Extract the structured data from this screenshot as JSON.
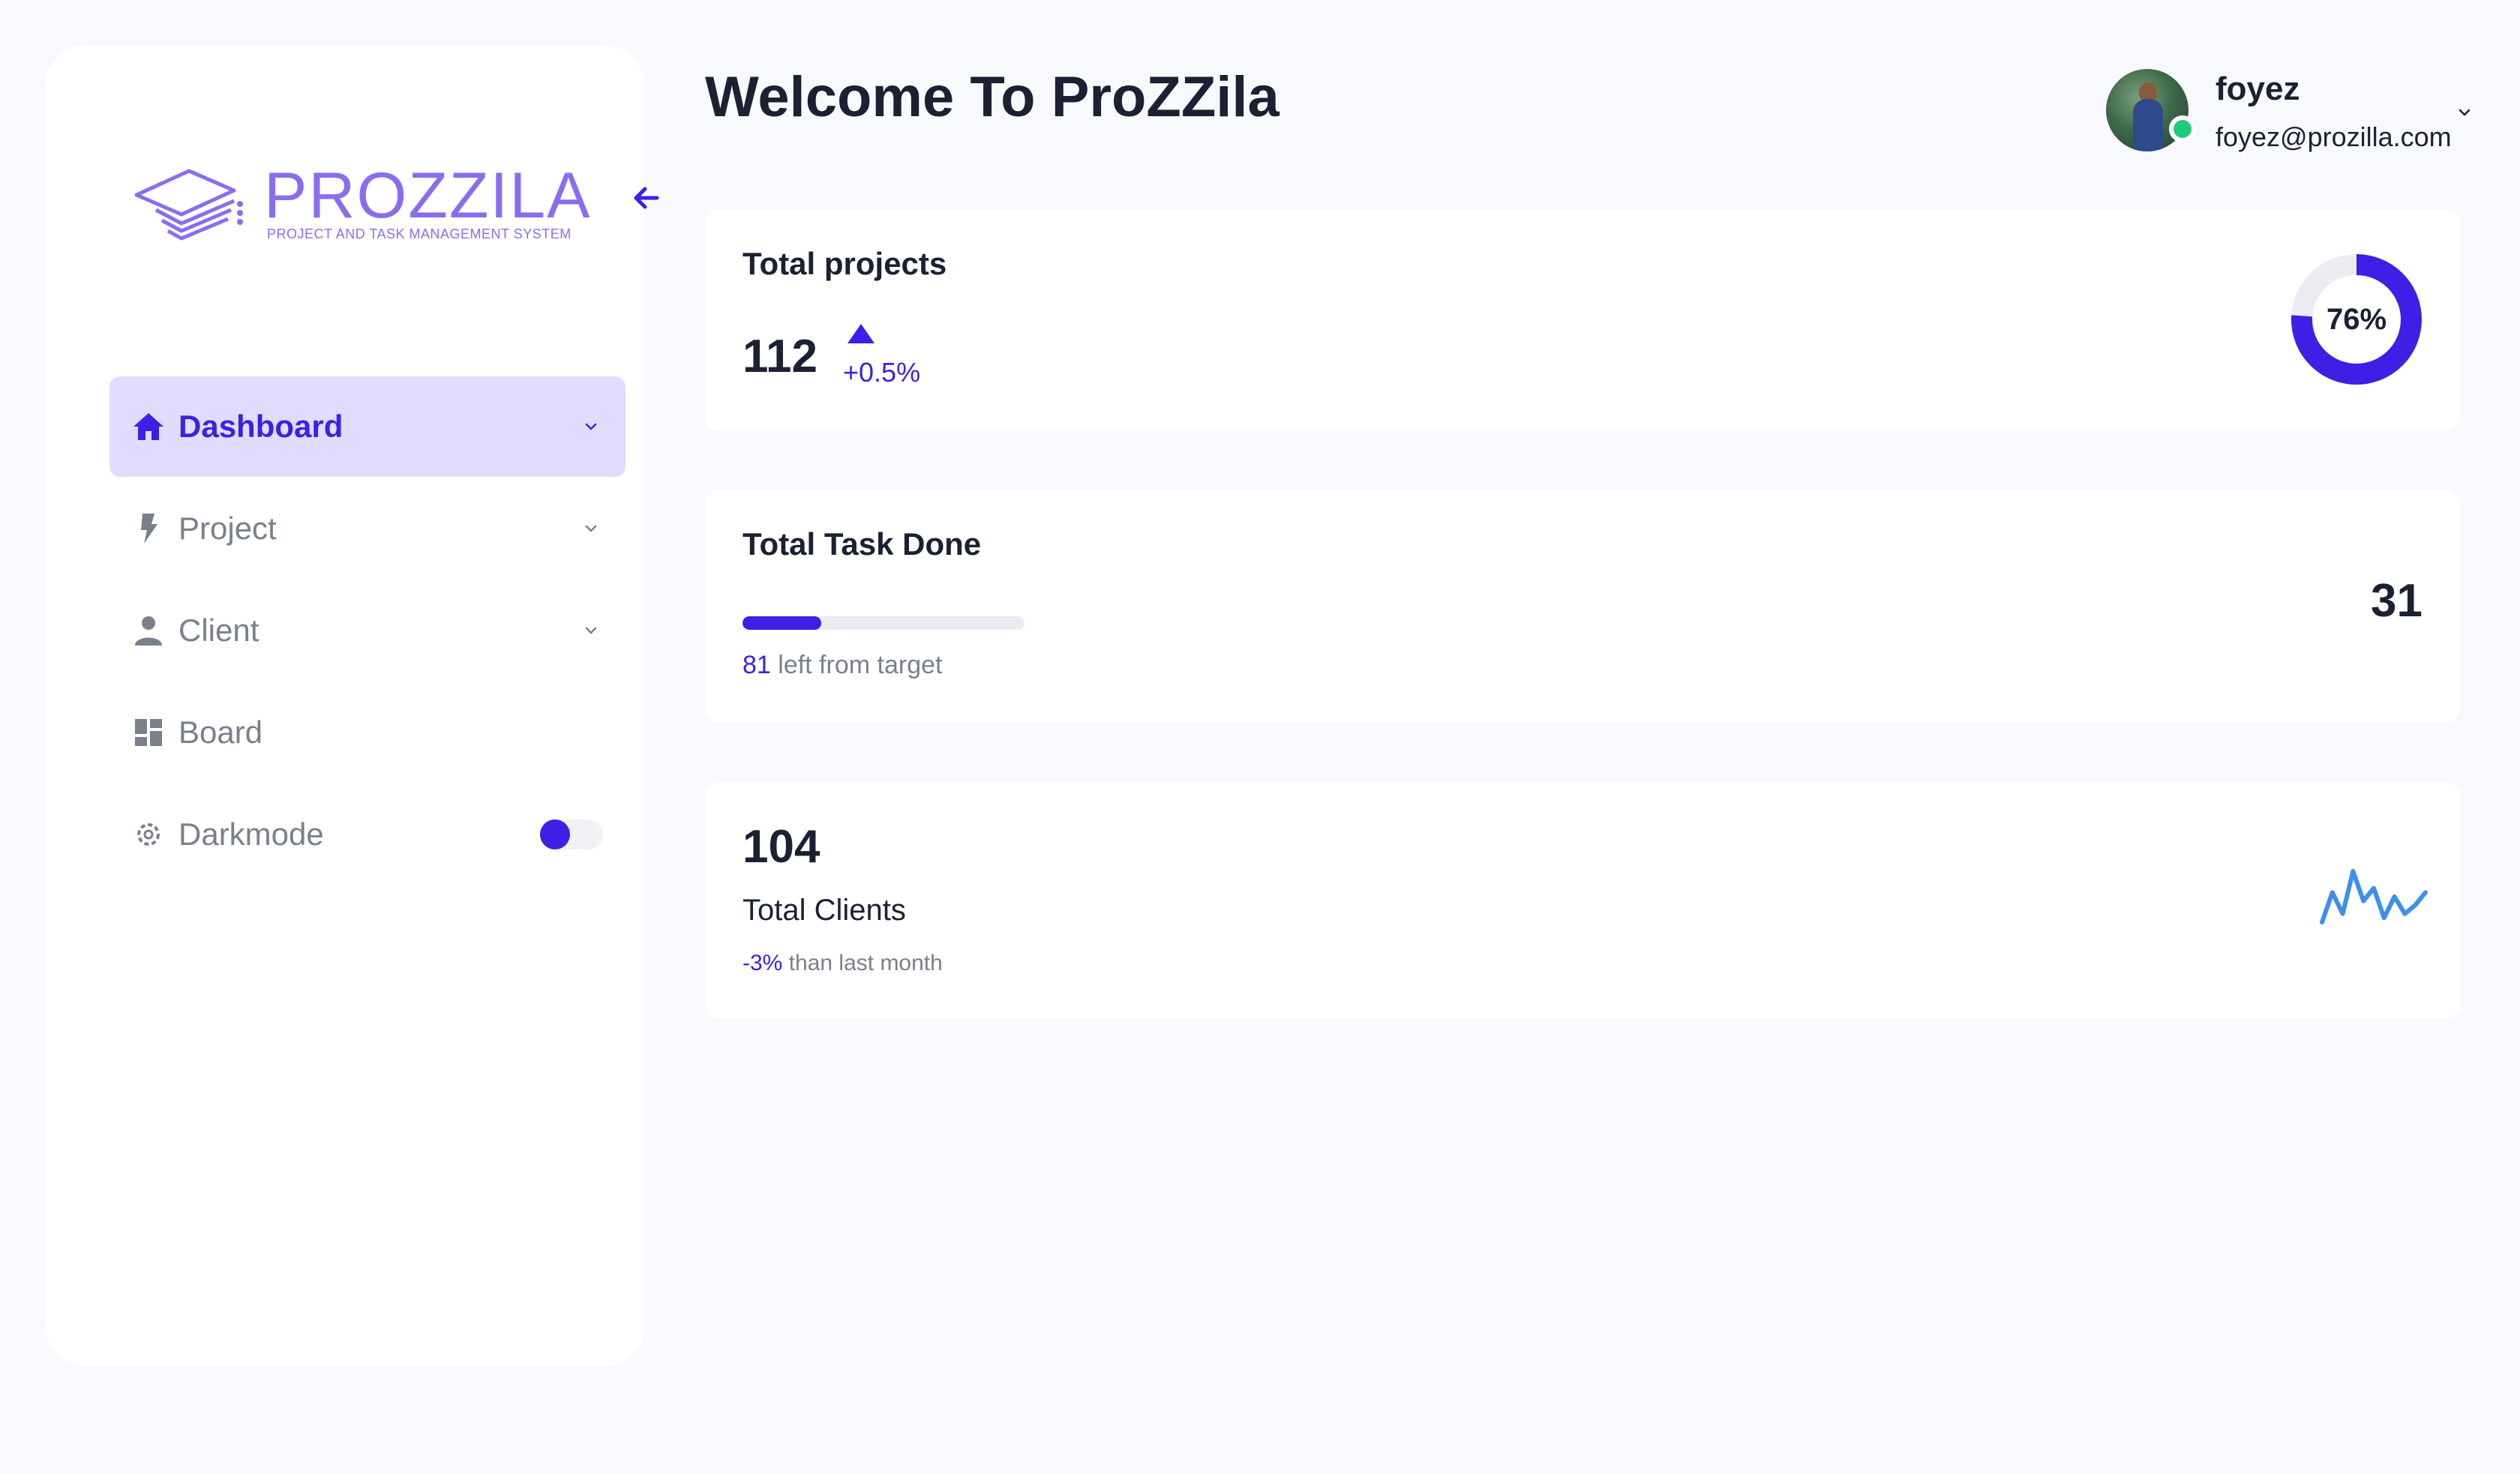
{
  "brand": {
    "name": "PROZZILA",
    "tagline": "PROJECT AND TASK MANAGEMENT SYSTEM",
    "color": "#8b6cf0"
  },
  "sidebar": {
    "items": [
      {
        "label": "Dashboard",
        "icon": "home-icon",
        "active": true,
        "has_submenu": true
      },
      {
        "label": "Project",
        "icon": "bolt-icon",
        "active": false,
        "has_submenu": true
      },
      {
        "label": "Client",
        "icon": "user-icon",
        "active": false,
        "has_submenu": true
      },
      {
        "label": "Board",
        "icon": "grid-icon",
        "active": false,
        "has_submenu": false
      },
      {
        "label": "Darkmode",
        "icon": "gear-icon",
        "active": false,
        "toggle": true
      }
    ]
  },
  "header": {
    "title": "Welcome To ProZZila"
  },
  "user": {
    "name": "foyez",
    "email": "foyez@prozilla.com",
    "status": "online"
  },
  "cards": {
    "projects": {
      "title": "Total projects",
      "value": "112",
      "change": "+0.5%",
      "percent_label": "76%",
      "percent": 0.76
    },
    "tasks": {
      "title": "Total Task Done",
      "value": "31",
      "left_count": "81",
      "left_text": " left from target",
      "progress": 0.28
    },
    "clients": {
      "value": "104",
      "label": "Total Clients",
      "change": "-3%",
      "change_text": " than last month",
      "sparkline": [
        20,
        55,
        30,
        80,
        45,
        60,
        25,
        50,
        30,
        40,
        55
      ]
    }
  },
  "colors": {
    "accent": "#3d1fe6",
    "active_bg": "#e1dcfd",
    "text_dark": "#1b2033",
    "text_muted": "#7a7f8c",
    "online": "#21c97a",
    "sparkline": "#3d8ef0"
  }
}
